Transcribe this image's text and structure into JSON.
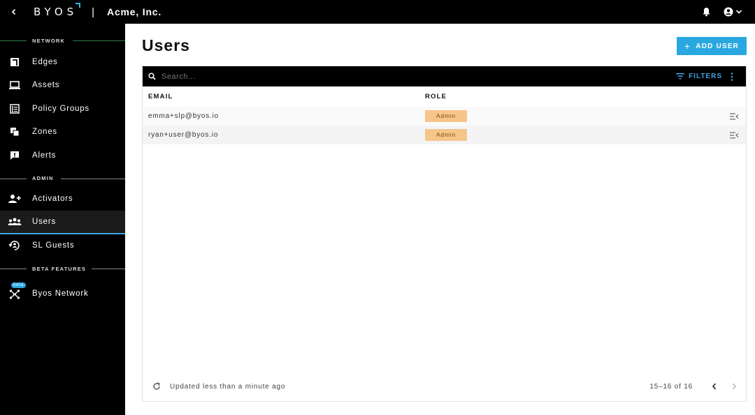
{
  "header": {
    "logo": "BYOS",
    "separator": "|",
    "org_name": "Acme, Inc."
  },
  "sidebar": {
    "sections": [
      {
        "label": "NETWORK",
        "line_color": "#2f7d4a"
      },
      {
        "label": "ADMIN",
        "line_color": "#888888"
      },
      {
        "label": "BETA FEATURES",
        "line_color": "#888888"
      }
    ],
    "items": [
      {
        "label": "Edges",
        "icon": "edges-icon"
      },
      {
        "label": "Assets",
        "icon": "laptop-icon"
      },
      {
        "label": "Policy Groups",
        "icon": "policy-list-icon"
      },
      {
        "label": "Zones",
        "icon": "zones-icon"
      },
      {
        "label": "Alerts",
        "icon": "alert-icon"
      },
      {
        "label": "Activators",
        "icon": "person-add-icon"
      },
      {
        "label": "Users",
        "icon": "group-icon",
        "active": true
      },
      {
        "label": "SL Guests",
        "icon": "guests-icon"
      },
      {
        "label": "Byos Network",
        "icon": "network-icon",
        "badge": "beta"
      }
    ]
  },
  "main": {
    "title": "Users",
    "add_button": "ADD USER",
    "search_placeholder": "Search...",
    "filters_label": "FILTERS",
    "columns": [
      "EMAIL",
      "ROLE"
    ],
    "rows": [
      {
        "email": "emma+slp@byos.io",
        "role": "Admin"
      },
      {
        "email": "ryan+user@byos.io",
        "role": "Admin"
      }
    ],
    "footer": {
      "updated": "Updated less than a minute ago",
      "range": "15–16 of 16"
    }
  },
  "colors": {
    "accent": "#29a8e0",
    "active_underline": "#3fa3e6",
    "badge_bg": "#f6c58a",
    "sidebar_bg": "#000000"
  }
}
